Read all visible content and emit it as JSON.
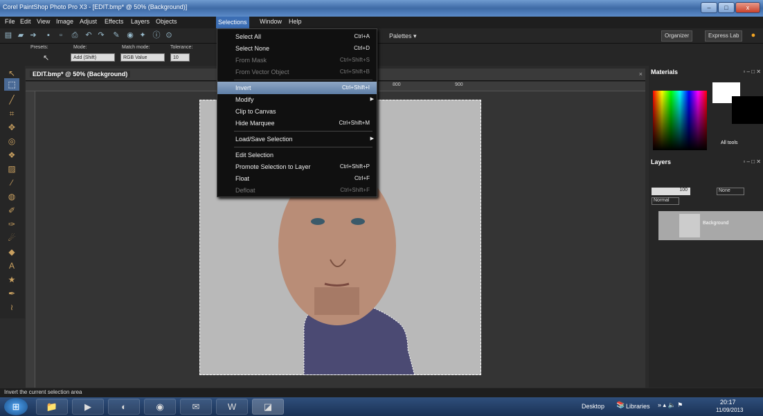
{
  "window": {
    "title": "Corel PaintShop Photo Pro X3 - [EDIT.bmp* @ 50% (Background)]",
    "minimize": "–",
    "maximize": "□",
    "close": "x"
  },
  "menubar": [
    "File",
    "Edit",
    "View",
    "Image",
    "Adjust",
    "Effects",
    "Layers",
    "Objects",
    "Selections",
    "Window",
    "Help"
  ],
  "toolbar": {
    "palettes": "Palettes ▾",
    "organizer": "Organizer",
    "express_lab": "Express Lab"
  },
  "tool_options": {
    "presets_label": "Presets:",
    "mode_label": "Mode:",
    "mode_value": "Add (Shift)",
    "match_label": "Match mode:",
    "match_value": "RGB Value",
    "tolerance_label": "Tolerance:",
    "tolerance_value": "10"
  },
  "document": {
    "tab_label": "EDIT.bmp* @ 50% (Background)",
    "ruler_top": [
      "800",
      "900"
    ]
  },
  "selections_menu": [
    {
      "label": "Select All",
      "shortcut": "Ctrl+A",
      "disabled": false
    },
    {
      "label": "Select None",
      "shortcut": "Ctrl+D",
      "disabled": false
    },
    {
      "label": "From Mask",
      "shortcut": "Ctrl+Shift+S",
      "disabled": true
    },
    {
      "label": "From Vector Object",
      "shortcut": "Ctrl+Shift+B",
      "disabled": true
    },
    {
      "label": "Invert",
      "shortcut": "Ctrl+Shift+I",
      "disabled": false,
      "highlighted": true
    },
    {
      "label": "Modify",
      "shortcut": "",
      "submenu": true
    },
    {
      "label": "Clip to Canvas",
      "shortcut": ""
    },
    {
      "label": "Hide Marquee",
      "shortcut": "Ctrl+Shift+M"
    },
    {
      "label": "Load/Save Selection",
      "shortcut": "",
      "submenu": true
    },
    {
      "label": "Edit Selection",
      "shortcut": ""
    },
    {
      "label": "Promote Selection to Layer",
      "shortcut": "Ctrl+Shift+P"
    },
    {
      "label": "Float",
      "shortcut": "Ctrl+F"
    },
    {
      "label": "Defloat",
      "shortcut": "Ctrl+Shift+F",
      "disabled": true
    }
  ],
  "materials": {
    "title": "Materials",
    "all_tools": "All tools"
  },
  "layers": {
    "title": "Layers",
    "opacity": "100",
    "blend": "Normal",
    "none": "None",
    "layer_name": "Background"
  },
  "status": {
    "text": "Invert the current selection area"
  },
  "taskbar": {
    "desktop": "Desktop",
    "libraries": "Libraries",
    "time": "20:17",
    "date": "11/09/2013"
  },
  "colors": {
    "accent": "#3c6eb4",
    "canvas_bg": "#b9b9b9"
  }
}
